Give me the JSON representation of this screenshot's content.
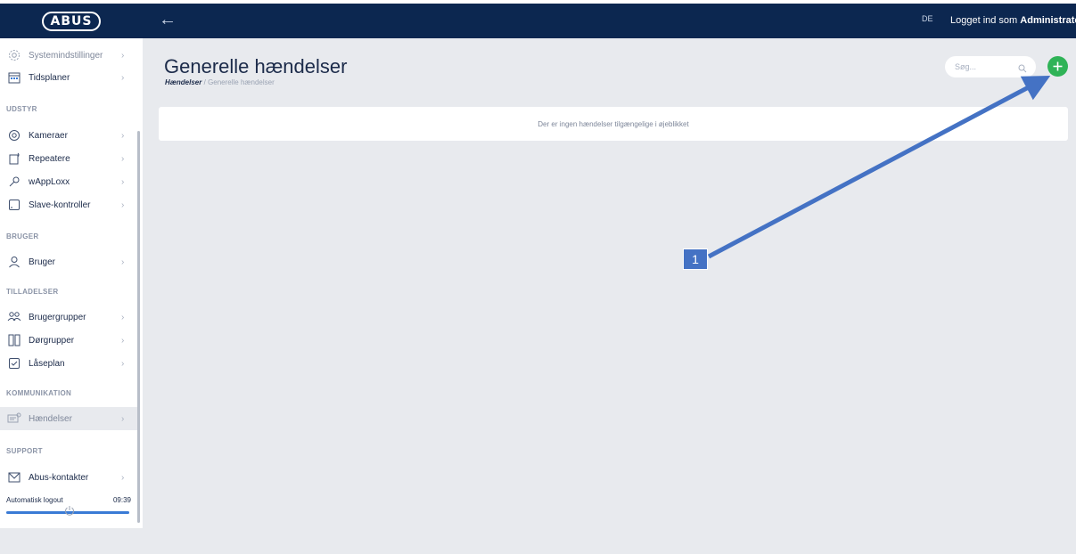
{
  "header": {
    "logo_text": "ABUS",
    "back_icon": "arrow-left-icon",
    "language": "DE",
    "user_prefix": "Logget ind som",
    "user_name": "Administrator"
  },
  "sidebar": {
    "items_top": [
      {
        "label": "Systemindstillinger",
        "icon": "gear-icon"
      },
      {
        "label": "Tidsplaner",
        "icon": "calendar-icon"
      }
    ],
    "sections": [
      {
        "title": "UDSTYR",
        "items": [
          {
            "label": "Kameraer",
            "icon": "camera-icon"
          },
          {
            "label": "Repeatere",
            "icon": "repeater-icon"
          },
          {
            "label": "wAppLoxx",
            "icon": "key-icon"
          },
          {
            "label": "Slave-kontroller",
            "icon": "tablet-icon"
          }
        ]
      },
      {
        "title": "BRUGER",
        "items": [
          {
            "label": "Bruger",
            "icon": "user-icon"
          }
        ]
      },
      {
        "title": "TILLADELSER",
        "items": [
          {
            "label": "Brugergrupper",
            "icon": "users-icon"
          },
          {
            "label": "Dørgrupper",
            "icon": "door-icon"
          },
          {
            "label": "Låseplan",
            "icon": "checkbox-icon"
          }
        ]
      },
      {
        "title": "KOMMUNIKATION",
        "items": [
          {
            "label": "Hændelser",
            "icon": "chat-icon",
            "active": true
          }
        ]
      },
      {
        "title": "SUPPORT",
        "items": [
          {
            "label": "Abus-kontakter",
            "icon": "envelope-icon"
          }
        ]
      }
    ],
    "auto_logout_label": "Automatisk logout",
    "auto_logout_time": "09:39",
    "auto_logout_progress": 1.0
  },
  "main": {
    "title": "Generelle hændelser",
    "breadcrumb_link": "Hændelser",
    "breadcrumb_separator": "/",
    "breadcrumb_current": "Generelle hændelser",
    "search_placeholder": "Søg...",
    "empty_message": "Der er ingen hændelser tilgængelige i øjeblikket"
  },
  "annotation": {
    "callout_number": "1",
    "color": "#4472c4"
  },
  "colors": {
    "topbar": "#0c2750",
    "add_button": "#2fb357",
    "background": "#e8eaee"
  }
}
